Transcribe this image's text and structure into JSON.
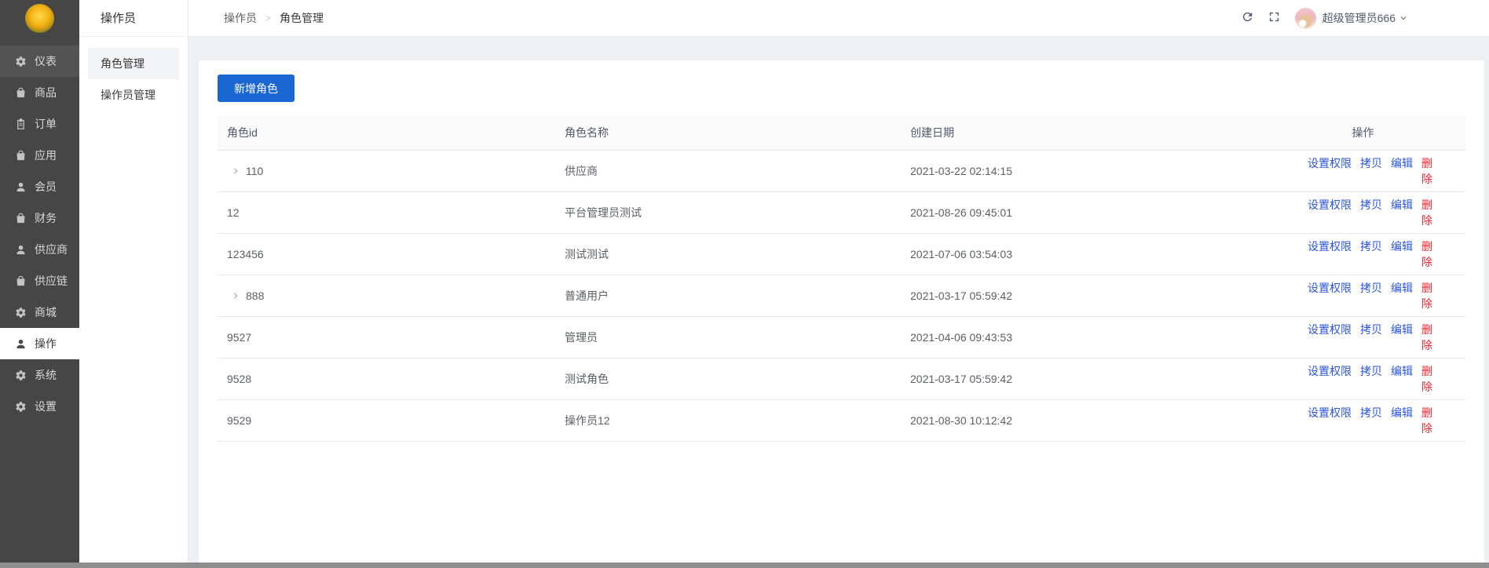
{
  "topbar": {
    "breadcrumb": [
      "操作员",
      "角色管理"
    ],
    "user_name": "超级管理员666",
    "refresh_icon": "refresh-icon",
    "fullscreen_icon": "fullscreen-icon",
    "user_caret_icon": "chevron-down-icon"
  },
  "sidebar": {
    "logo_icon": "tulip-avatar-logo",
    "items": [
      {
        "label": "仪表",
        "icon": "gear-icon",
        "highlight": true
      },
      {
        "label": "商品",
        "icon": "bag-icon"
      },
      {
        "label": "订单",
        "icon": "order-icon"
      },
      {
        "label": "应用",
        "icon": "bag-icon"
      },
      {
        "label": "会员",
        "icon": "user-icon"
      },
      {
        "label": "财务",
        "icon": "bag-icon"
      },
      {
        "label": "供应商",
        "icon": "user-icon"
      },
      {
        "label": "供应链",
        "icon": "bag-icon"
      },
      {
        "label": "商城",
        "icon": "gear-icon"
      },
      {
        "label": "操作",
        "icon": "user-icon",
        "active": true
      },
      {
        "label": "系统",
        "icon": "gear-icon"
      },
      {
        "label": "设置",
        "icon": "gear-icon"
      }
    ]
  },
  "submenu": {
    "title": "操作员",
    "items": [
      {
        "label": "角色管理",
        "active": true
      },
      {
        "label": "操作员管理",
        "active": false
      }
    ]
  },
  "content": {
    "add_button": "新增角色",
    "table": {
      "columns": [
        "角色id",
        "角色名称",
        "创建日期",
        "操作"
      ],
      "action_labels": [
        "设置权限",
        "拷贝",
        "编辑",
        "删除"
      ],
      "rows": [
        {
          "id": "110",
          "expandable": true,
          "name": "供应商",
          "created": "2021-03-22 02:14:15"
        },
        {
          "id": "12",
          "expandable": false,
          "name": "平台管理员测试",
          "created": "2021-08-26 09:45:01"
        },
        {
          "id": "123456",
          "expandable": false,
          "name": "测试测试",
          "created": "2021-07-06 03:54:03"
        },
        {
          "id": "888",
          "expandable": true,
          "name": "普通用户",
          "created": "2021-03-17 05:59:42"
        },
        {
          "id": "9527",
          "expandable": false,
          "name": "管理员",
          "created": "2021-04-06 09:43:53"
        },
        {
          "id": "9528",
          "expandable": false,
          "name": "测试角色",
          "created": "2021-03-17 05:59:42"
        },
        {
          "id": "9529",
          "expandable": false,
          "name": "操作员12",
          "created": "2021-08-30 10:12:42"
        }
      ]
    }
  },
  "colors": {
    "primary_button": "#1a66d2",
    "link": "#2b56dd",
    "danger": "#f5222d",
    "sidebar_bg": "#464646",
    "sidebar_active_bg": "#ffffff",
    "content_bg": "#eef0f4",
    "table_header_bg": "#fafafa"
  }
}
